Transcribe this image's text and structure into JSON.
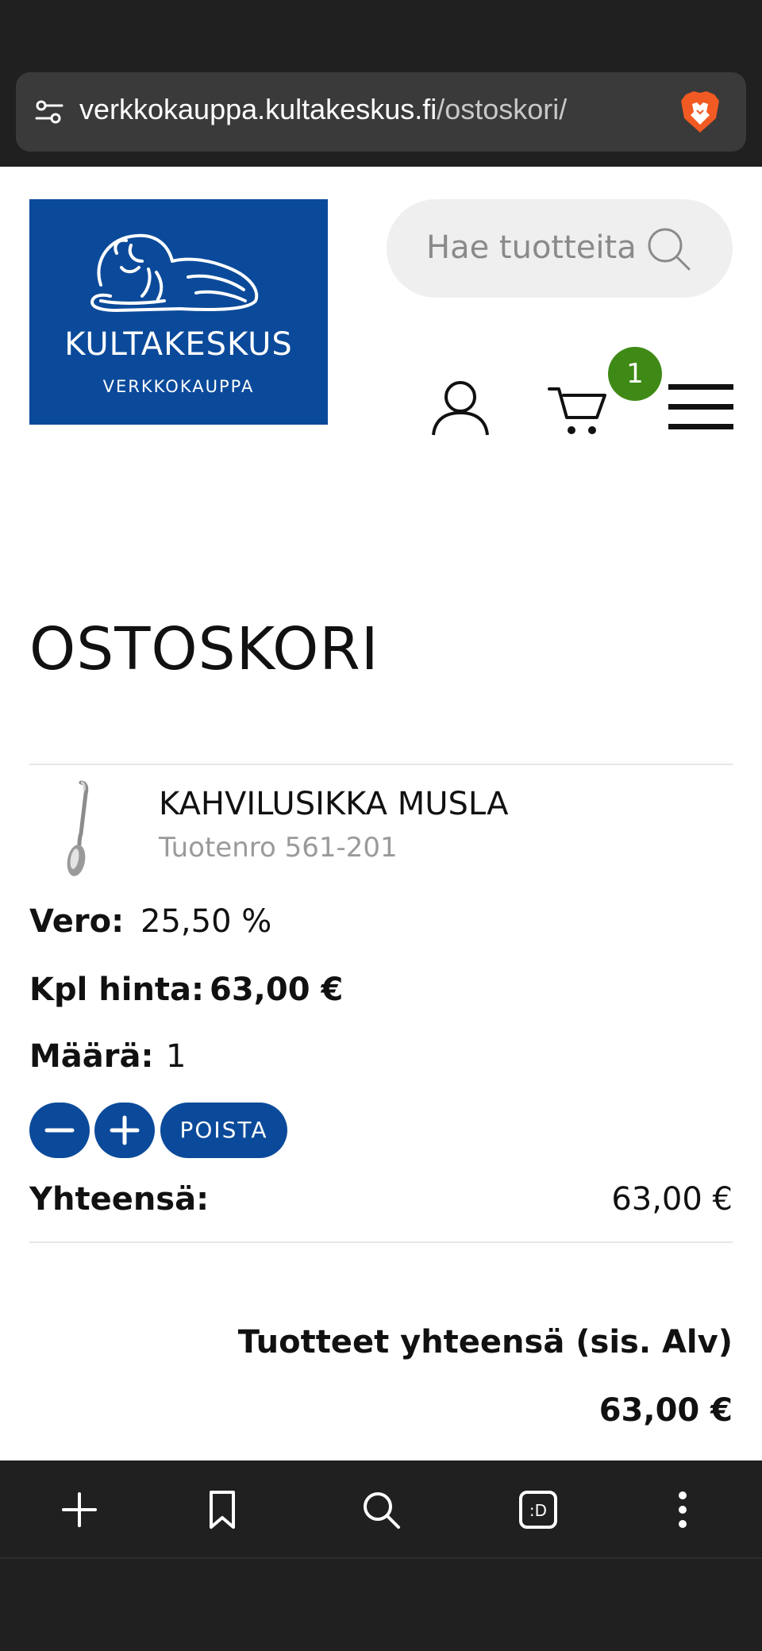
{
  "browser": {
    "url_host": "verkkokauppa.kultakeskus.fi",
    "url_path": "/ostoskori/"
  },
  "header": {
    "logo_name": "KULTAKESKUS",
    "logo_sub": "VERKKOKAUPPA",
    "search_placeholder": "Hae tuotteita",
    "cart_count": "1"
  },
  "page": {
    "title": "OSTOSKORI"
  },
  "cart_item": {
    "name": "KAHVILUSIKKA MUSLA",
    "sku": "Tuotenro 561-201",
    "tax_label": "Vero:",
    "tax_value": "25,50 %",
    "unit_price_label": "Kpl hinta:",
    "unit_price_value": "63,00 €",
    "quantity_label": "Määrä:",
    "quantity_value": "1",
    "remove_label": "POISTA",
    "subtotal_label": "Yhteensä:",
    "subtotal_value": "63,00 €"
  },
  "summary": {
    "total_label": "Tuotteet yhteensä (sis. Alv)",
    "total_value": "63,00 €"
  },
  "colors": {
    "brand_blue": "#0b4a9a",
    "badge_green": "#3f8a16",
    "chrome_dark": "#202020"
  },
  "toolbar_icons": [
    "plus-icon",
    "bookmark-icon",
    "search-icon",
    "tab-switcher-icon",
    "more-icon"
  ]
}
